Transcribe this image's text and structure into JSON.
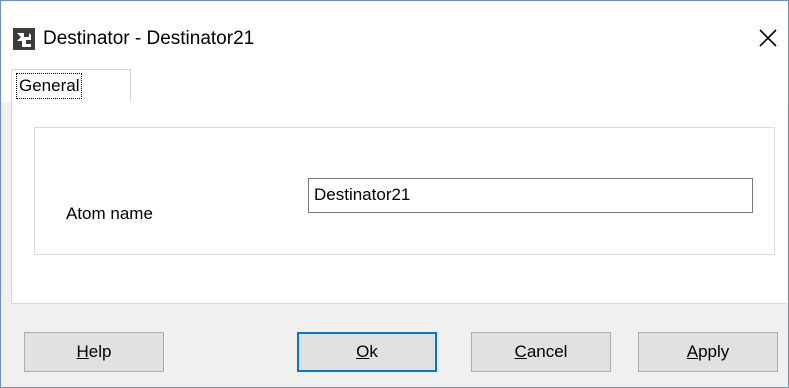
{
  "window": {
    "title": "Destinator - Destinator21",
    "app_icon": "destinator-app-icon",
    "close_icon": "close-icon"
  },
  "tabs": [
    {
      "label": "General",
      "active": true
    }
  ],
  "form": {
    "atom_name_label": "Atom name",
    "atom_name_value": "Destinator21"
  },
  "buttons": {
    "help": {
      "label_first": "H",
      "label_rest": "elp"
    },
    "ok": {
      "label_first": "O",
      "label_rest": "k"
    },
    "cancel": {
      "label_first": "C",
      "label_rest": "ancel"
    },
    "apply": {
      "label_first": "A",
      "label_rest": "pply"
    }
  },
  "colors": {
    "accent": "#0078d7",
    "window_border": "#6d8fb8",
    "button_face": "#e1e1e1"
  }
}
